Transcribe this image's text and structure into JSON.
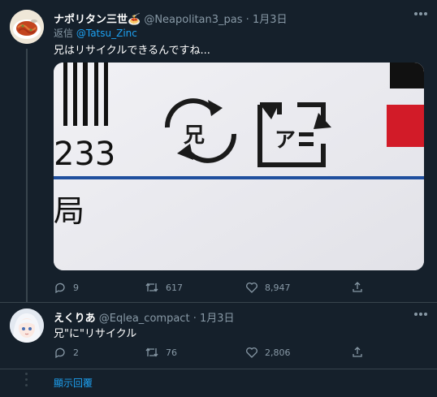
{
  "tweet1": {
    "display_name": "ナポリタン三世🍝",
    "handle": "@Neapolitan3_pas",
    "separator": "·",
    "date": "1月3日",
    "reply_label": "返信",
    "reply_handle": "@Tatsu_Zinc",
    "text": "兄はリサイクルできるんですね...",
    "media": {
      "barcode_number": "233",
      "bottom_text": "局",
      "recycle_mark_left": "兄",
      "recycle_mark_right": "ア"
    },
    "replies": "9",
    "retweets": "617",
    "likes": "8,947"
  },
  "tweet2": {
    "display_name": "えくりあ",
    "handle": "@Eqlea_compact",
    "separator": "·",
    "date": "1月3日",
    "text": "兄\"に\"リサイクル",
    "replies": "2",
    "retweets": "76",
    "likes": "2,806"
  },
  "more_replies_label": "顯示回覆",
  "colors": {
    "background": "#15202b",
    "link": "#1da1f2",
    "secondary_text": "#8899a6",
    "divider": "#38444d"
  }
}
